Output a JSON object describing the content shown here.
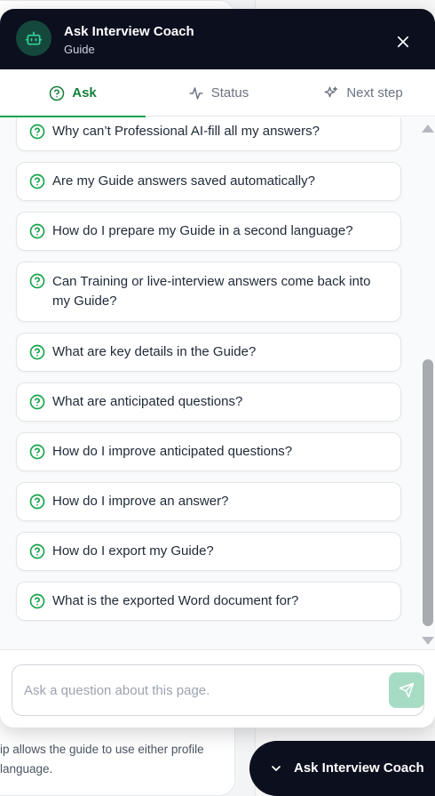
{
  "background": {
    "helper_text_line1": "ip allows the guide to use either profile",
    "helper_text_line2": "language."
  },
  "header": {
    "title": "Ask Interview Coach",
    "subtitle": "Guide",
    "bot_icon": "robot-icon",
    "close_icon": "close-icon",
    "bg_color": "#0b0f1e"
  },
  "tabs": [
    {
      "label": "Ask",
      "icon": "question-circle-icon",
      "active": true
    },
    {
      "label": "Status",
      "icon": "activity-icon",
      "active": false
    },
    {
      "label": "Next step",
      "icon": "sparkles-icon",
      "active": false
    }
  ],
  "questions": [
    "Why can’t Professional AI-fill all my answers?",
    "Are my Guide answers saved automatically?",
    "How do I prepare my Guide in a second language?",
    "Can Training or live-interview answers come back into my Guide?",
    "What are key details in the Guide?",
    "What are anticipated questions?",
    "How do I improve anticipated questions?",
    "How do I improve an answer?",
    "How do I export my Guide?",
    "What is the exported Word document for?"
  ],
  "input": {
    "placeholder": "Ask a question about this page.",
    "value": "",
    "send_icon": "send-icon"
  },
  "launcher": {
    "label": "Ask Interview Coach",
    "icon": "chevron-down-icon"
  },
  "colors": {
    "accent": "#16a34a",
    "send_button": "#a7dcc4"
  }
}
